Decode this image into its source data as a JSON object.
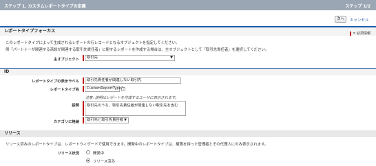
{
  "header": {
    "title": "ステップ 1. カスタムレポートタイプの定義",
    "step": "ステップ 1/2"
  },
  "actions": {
    "next": "次へ",
    "cancel": "キャンセル"
  },
  "focus_section": {
    "title": "レポートタイプフォーカス",
    "required_legend": "= 必須情報",
    "desc_line1": "このレポートタイプによって生成されるレポートの行レコードとなるオブジェクトを指定してください。",
    "desc_line2": "例「パートナーが関連する商談が関連する取引先責任者」に関するレポートを作成する場合は、主オブジェクトとして「取引先責任者」を選択してください。",
    "primary_object_label": "主オブジェクト",
    "primary_object_value": "取引先"
  },
  "id_section": {
    "title": "ID",
    "display_label_label": "レポートタイプの表示ラベル",
    "display_label_value": "取引先責任者が関連しない取引先",
    "name_label": "レポートタイプ名",
    "name_value": "CustomReportType2",
    "info_icon": "i",
    "hint": "注意: 説明はレポートを作成するユーザに表示されます。",
    "description_label": "説明",
    "description_value": "取引先のうち、取引先責任者が関連しない取引先を含む",
    "category_label": "カテゴリに格納",
    "category_value": "取引先と取引先責任者"
  },
  "release_section": {
    "title": "リリース",
    "desc": "リリース済みのレポートタイプは、レポートウィザードで使用できます。開発中のレポートタイプは、権限を持った管理者とその代理人にのみ表示されます。",
    "status_label": "リリース状況",
    "options": [
      "開発中",
      "リリース済み"
    ],
    "selected": "リリース済み"
  }
}
